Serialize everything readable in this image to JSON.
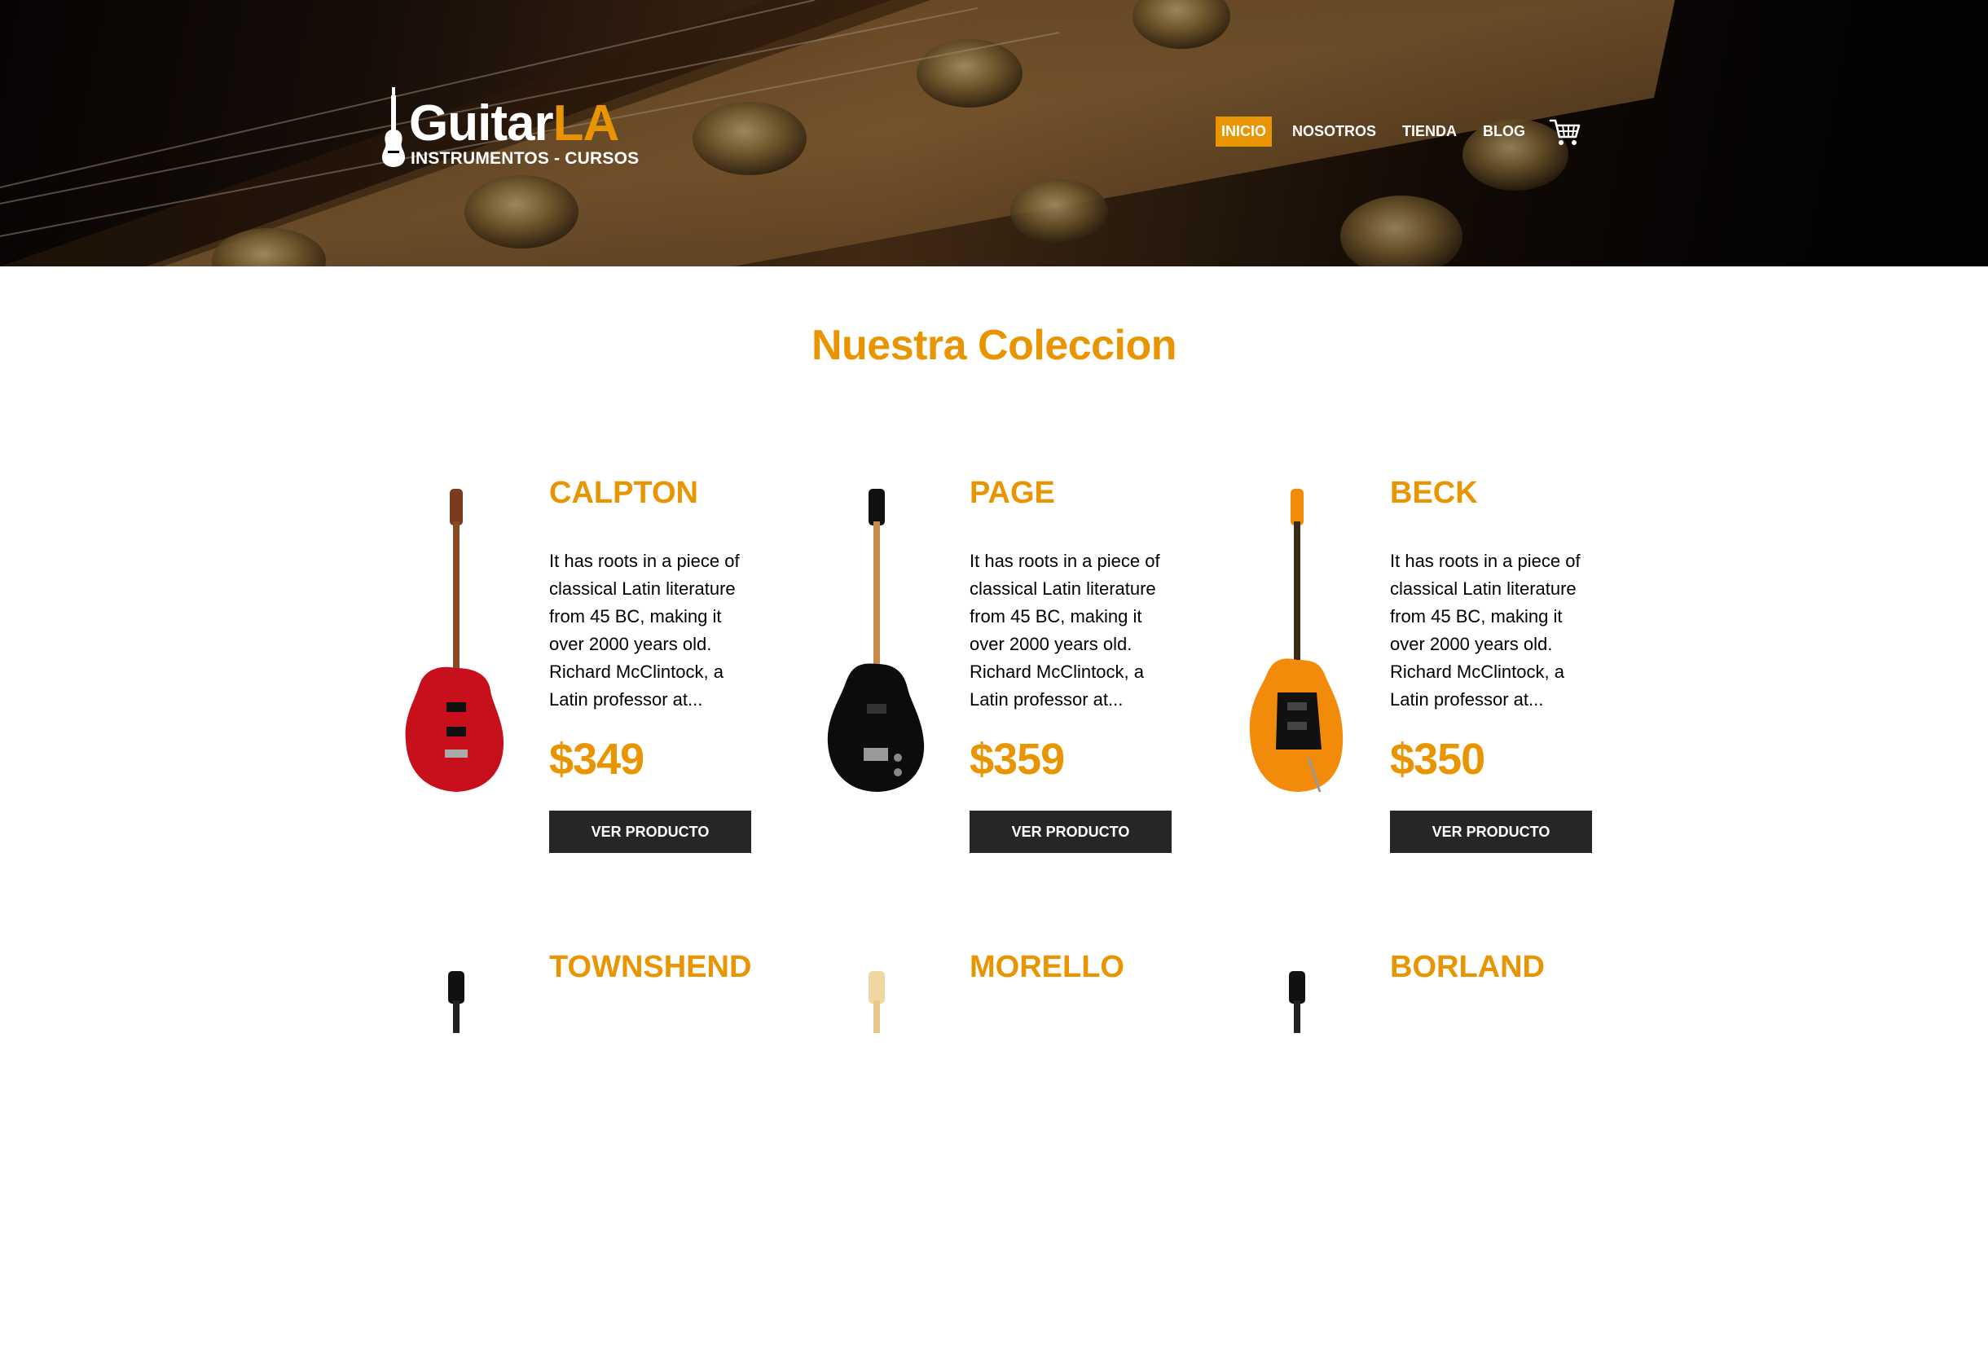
{
  "brand": {
    "name_part1": "Guitar",
    "name_part2": "LA",
    "tagline": "INSTRUMENTOS - CURSOS"
  },
  "nav": {
    "items": [
      {
        "label": "INICIO",
        "active": true
      },
      {
        "label": "NOSOTROS",
        "active": false
      },
      {
        "label": "TIENDA",
        "active": false
      },
      {
        "label": "BLOG",
        "active": false
      }
    ],
    "cart_icon": "cart-icon"
  },
  "colors": {
    "accent": "#e99401",
    "button_bg": "#262626",
    "text": "#000000"
  },
  "section_title": "Nuestra Coleccion",
  "products": [
    {
      "name": "CALPTON",
      "description": "It has roots in a piece of classical Latin literature from 45 BC, making it over 2000 years old. Richard McClintock, a Latin professor at...",
      "price": "$349",
      "button": "VER PRODUCTO",
      "body_color": "#c8101c"
    },
    {
      "name": "PAGE",
      "description": "It has roots in a piece of classical Latin literature from 45 BC, making it over 2000 years old. Richard McClintock, a Latin professor at...",
      "price": "$359",
      "button": "VER PRODUCTO",
      "body_color": "#0c0c0c"
    },
    {
      "name": "BECK",
      "description": "It has roots in a piece of classical Latin literature from 45 BC, making it over 2000 years old. Richard McClintock, a Latin professor at...",
      "price": "$350",
      "button": "VER PRODUCTO",
      "body_color": "#f28a0a"
    },
    {
      "name": "TOWNSHEND",
      "body_color": "#111111"
    },
    {
      "name": "MORELLO",
      "body_color": "#f0d6a0"
    },
    {
      "name": "BORLAND",
      "body_color": "#111111"
    }
  ]
}
